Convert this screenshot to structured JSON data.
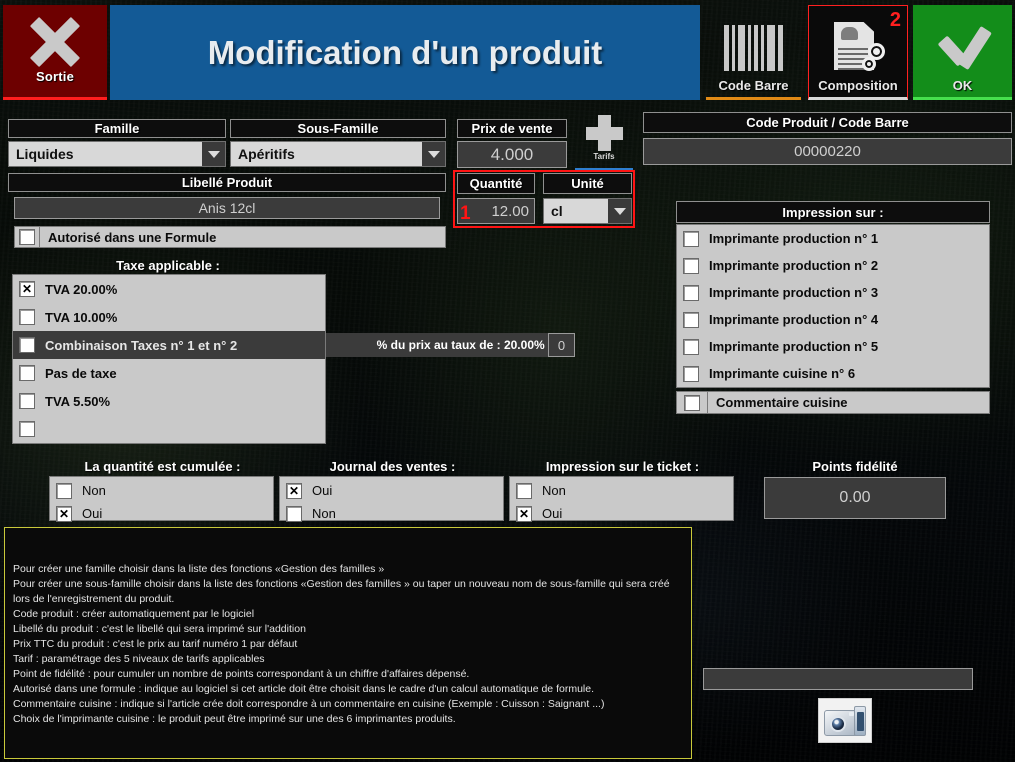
{
  "window": {
    "title": "Modification d'un produit"
  },
  "toolbar": {
    "exit_label": "Sortie",
    "barcode_label": "Code Barre",
    "composition_label": "Composition",
    "composition_badge": "2",
    "ok_label": "OK",
    "tarifs_label": "Tarifs"
  },
  "form": {
    "famille_label": "Famille",
    "famille_value": "Liquides",
    "sous_famille_label": "Sous-Famille",
    "sous_famille_value": "Apéritifs",
    "prix_label": "Prix de vente",
    "prix_value": "4.000",
    "libelle_label": "Libellé Produit",
    "libelle_value": "Anis 12cl",
    "formule_label": "Autorisé dans une Formule",
    "quantite_label": "Quantité",
    "quantite_value": "12.00",
    "unite_label": "Unité",
    "unite_value": "cl",
    "marker_1": "1",
    "code_label": "Code Produit / Code Barre",
    "code_value": "00000220"
  },
  "taxes": {
    "title": "Taxe applicable :",
    "items": [
      {
        "label": "TVA 20.00%",
        "checked": true
      },
      {
        "label": "TVA 10.00%",
        "checked": false
      },
      {
        "label": "Combinaison Taxes n° 1 et n° 2",
        "checked": false
      },
      {
        "label": "Pas de taxe",
        "checked": false
      },
      {
        "label": "TVA 5.50%",
        "checked": false
      },
      {
        "label": "",
        "checked": false
      }
    ],
    "combi_note": "% du prix au taux de : 20.00% :",
    "combi_value": "0"
  },
  "impression": {
    "title": "Impression sur :",
    "items": [
      {
        "label": "Imprimante production n° 1",
        "checked": false
      },
      {
        "label": "Imprimante production n° 2",
        "checked": false
      },
      {
        "label": "Imprimante production n° 3",
        "checked": false
      },
      {
        "label": "Imprimante production n° 4",
        "checked": false
      },
      {
        "label": "Imprimante production n° 5",
        "checked": false
      },
      {
        "label": "Imprimante cuisine n° 6",
        "checked": false
      }
    ],
    "comment_label": "Commentaire cuisine",
    "comment_checked": false
  },
  "groups": [
    {
      "title": "La quantité est cumulée :",
      "options": [
        {
          "label": "Non",
          "checked": false
        },
        {
          "label": "Oui",
          "checked": true
        }
      ]
    },
    {
      "title": "Journal des ventes :",
      "options": [
        {
          "label": "Oui",
          "checked": true
        },
        {
          "label": "Non",
          "checked": false
        }
      ]
    },
    {
      "title": "Impression sur le  ticket :",
      "options": [
        {
          "label": "Non",
          "checked": false
        },
        {
          "label": "Oui",
          "checked": true
        }
      ]
    }
  ],
  "fidelite": {
    "title": "Points fidélité",
    "value": "0.00"
  },
  "help": {
    "lines": [
      "Pour créer une famille choisir dans la liste des fonctions «Gestion des familles »",
      "Pour créer une sous-famille choisir dans la liste des fonctions «Gestion des familles » ou taper un nouveau nom de sous-famille qui sera créé lors de l'enregistrement du produit.",
      "Code produit : créer automatiquement par le logiciel",
      "Libellé du produit : c'est le libellé qui sera imprimé sur l'addition",
      "Prix TTC du produit : c'est le prix au tarif numéro 1 par défaut",
      "Tarif : paramétrage des 5 niveaux de tarifs applicables",
      "Point de fidélité : pour cumuler un nombre de points correspondant à un chiffre d'affaires dépensé.",
      "Autorisé dans une formule : indique au logiciel si cet article doit être choisit dans le cadre d'un calcul automatique de formule.",
      "Commentaire cuisine : indique si l'article crée doit correspondre à un commentaire en cuisine (Exemple : Cuisson : Saignant ...)",
      "Choix de l'imprimante cuisine : le produit peut être imprimé sur une des 6 imprimantes produits."
    ]
  },
  "photo": {
    "value": ""
  },
  "colors": {
    "title_bar": "#135a96",
    "exit": "#6d0000",
    "ok": "#138d1a",
    "accent_red": "#ff1414",
    "accent_orange": "#e08a16",
    "help_border": "#c9c93a"
  }
}
